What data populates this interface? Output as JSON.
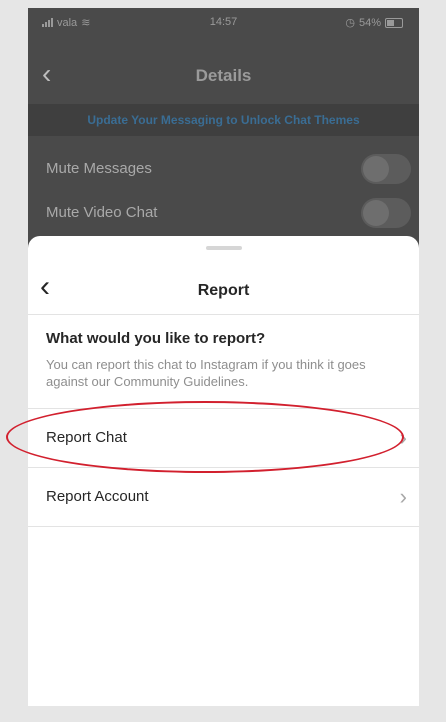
{
  "status_bar": {
    "carrier": "vala",
    "time": "14:57",
    "battery": "54%"
  },
  "background": {
    "title": "Details",
    "banner": "Update Your Messaging to Unlock Chat Themes",
    "rows": [
      {
        "label": "Mute Messages"
      },
      {
        "label": "Mute Video Chat"
      }
    ]
  },
  "sheet": {
    "title": "Report",
    "question": "What would you like to report?",
    "description": "You can report this chat to Instagram if you think it goes against our Community Guidelines.",
    "options": [
      {
        "label": "Report Chat"
      },
      {
        "label": "Report Account"
      }
    ]
  },
  "colors": {
    "highlight": "#d2202e",
    "overlay": "#4a4a4a"
  }
}
